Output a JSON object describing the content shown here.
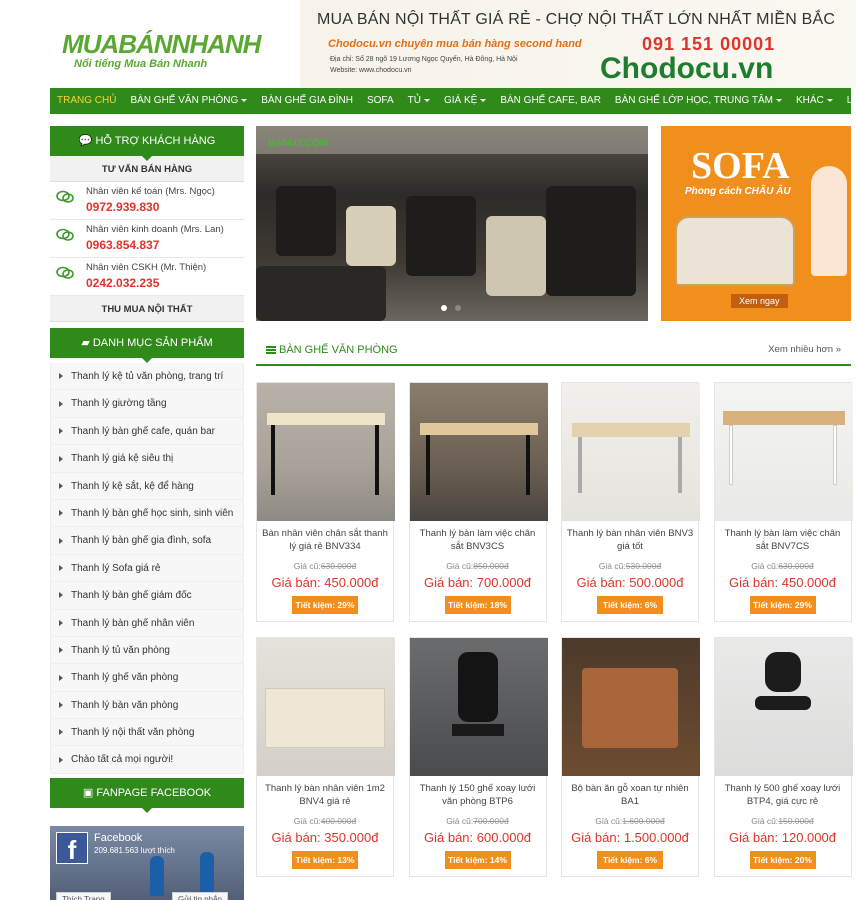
{
  "header": {
    "logo_main_1": "MUABÁN",
    "logo_main_2": "NHANH",
    "logo_tagline": "Nổi tiếng Mua Bán Nhanh",
    "slogan": "MUA BÁN NỘI THẤT GIÁ RẺ - CHỢ NỘI THẤT LỚN NHẤT MIỀN BẮC",
    "tagline": "Chodocu.vn chuyên mua bán hàng  second hand",
    "address": "Địa chỉ: Số 28 ngõ 19 Lương Ngọc Quyến, Hà Đông, Hà Nội",
    "website": "Website: www.chodocu.vn",
    "phone": "091 151 00001",
    "brand": "Chodocu.vn"
  },
  "nav": [
    {
      "label": "TRANG CHỦ",
      "active": true,
      "caret": false
    },
    {
      "label": "BÀN GHẾ VĂN PHÒNG",
      "active": false,
      "caret": true
    },
    {
      "label": "BÀN GHẾ GIA ĐÌNH",
      "active": false,
      "caret": false
    },
    {
      "label": "SOFA",
      "active": false,
      "caret": false
    },
    {
      "label": "TỦ",
      "active": false,
      "caret": true
    },
    {
      "label": "GIÁ KỆ",
      "active": false,
      "caret": true
    },
    {
      "label": "BÀN GHẾ CAFE, BAR",
      "active": false,
      "caret": false
    },
    {
      "label": "BÀN GHẾ LỚP HỌC, TRUNG TÂM",
      "active": false,
      "caret": true
    },
    {
      "label": "KHÁC",
      "active": false,
      "caret": true
    },
    {
      "label": "LIÊN HỆ",
      "active": false,
      "caret": false
    }
  ],
  "sidebar": {
    "support_title": "HỖ TRỢ KHÁCH HÀNG",
    "sales_title": "TƯ VẤN BÁN HÀNG",
    "staff": [
      {
        "name": "Nhân viên kế toán (Mrs. Ngọc)",
        "phone": "0972.939.830"
      },
      {
        "name": "Nhân viên kinh doanh (Mrs. Lan)",
        "phone": "0963.854.837"
      },
      {
        "name": "Nhân viên CSKH (Mr. Thiện)",
        "phone": "0242.032.235"
      }
    ],
    "buy_title": "THU MUA NỘI THẤT",
    "category_title": "DANH MỤC SẢN PHẨM",
    "categories": [
      "Thanh lý kệ tủ văn phòng, trang trí",
      "Thanh lý giường tầng",
      "Thanh lý bàn ghế cafe, quán bar",
      "Thanh lý giá kệ siêu thị",
      "Thanh lý kệ sắt, kệ để hàng",
      "Thanh lý bàn ghế học sinh, sinh viên",
      "Thanh lý bàn ghế gia đình, sofa",
      "Thanh lý Sofa giá rẻ",
      "Thanh lý bàn ghế giám đốc",
      "Thanh lý bàn ghế nhân viên",
      "Thanh lý tủ văn phòng",
      "Thanh lý ghế văn phòng",
      "Thanh lý bàn văn phòng",
      "Thanh lý nội thất văn phòng",
      "Chào tất cả mọi người!"
    ],
    "fanpage_title": "FANPAGE FACEBOOK",
    "fb_name": "Facebook",
    "fb_likes": "209.681.563 lượt thích",
    "fb_like_btn": "Thích Trang",
    "fb_msg_btn": "Gửi tin nhắn"
  },
  "slider": {
    "watermark": "BANUT.COM"
  },
  "ad": {
    "title": "SOFA",
    "subtitle": "Phong cách CHÂU ÂU",
    "cta": "Xem ngay"
  },
  "section": {
    "title": "BÀN GHẾ VĂN PHÒNG",
    "more": "Xem nhiều hơn »"
  },
  "products": [
    {
      "name": "Bàn nhân viên chân sắt thanh lý giá rẻ BNV334",
      "old_label": "Giá cũ:",
      "old": "630.000đ",
      "price": "Giá bán: 450.000đ",
      "save": "Tiết kiệm: 29%"
    },
    {
      "name": "Thanh lý bàn làm việc chân sắt BNV3CS",
      "old_label": "Giá cũ:",
      "old": "850.000đ",
      "price": "Giá bán: 700.000đ",
      "save": "Tiết kiệm: 18%"
    },
    {
      "name": "Thanh lý bàn nhân viên BNV3 giá tốt",
      "old_label": "Giá cũ:",
      "old": "530.000đ",
      "price": "Giá bán: 500.000đ",
      "save": "Tiết kiệm: 6%"
    },
    {
      "name": "Thanh lý bàn làm việc chân sắt BNV7CS",
      "old_label": "Giá cũ:",
      "old": "630.000đ",
      "price": "Giá bán: 450.000đ",
      "save": "Tiết kiệm: 29%"
    },
    {
      "name": "Thanh lý bàn nhân viên 1m2 BNV4 giá rẻ",
      "old_label": "Giá cũ:",
      "old": "400.000đ",
      "price": "Giá bán: 350.000đ",
      "save": "Tiết kiệm: 13%"
    },
    {
      "name": "Thanh lý 150 ghế xoay lưới văn phòng BTP6",
      "old_label": "Giá cũ:",
      "old": "700.000đ",
      "price": "Giá bán: 600.000đ",
      "save": "Tiết kiệm: 14%"
    },
    {
      "name": "Bộ bàn ăn gỗ xoan tự nhiên BA1",
      "old_label": "Giá cũ:",
      "old": "1.600.000đ",
      "price": "Giá bán: 1.500.000đ",
      "save": "Tiết kiệm: 6%"
    },
    {
      "name": "Thanh lý 500 ghế xoay lưới BTP4, giá cực rẻ",
      "old_label": "Giá cũ:",
      "old": "150.000đ",
      "price": "Giá bán: 120.000đ",
      "save": "Tiết kiệm: 20%"
    }
  ],
  "colors": {
    "green": "#2f8a1a",
    "orange": "#f18f1c",
    "red": "#e0332b"
  }
}
